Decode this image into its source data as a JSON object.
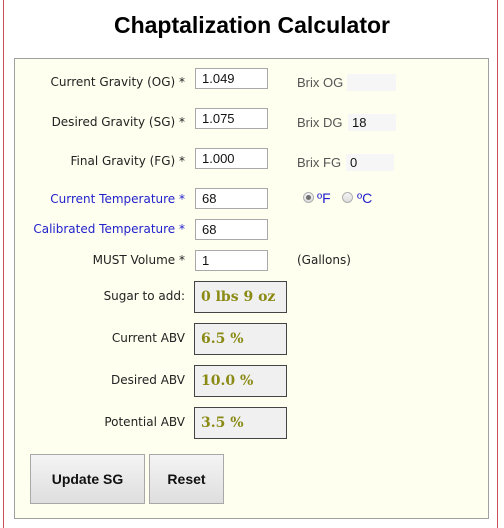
{
  "title": "Chaptalization Calculator",
  "fields": {
    "og": {
      "label": "Current Gravity (OG) *",
      "value": "1.049"
    },
    "sg": {
      "label": "Desired Gravity (SG) *",
      "value": "1.075"
    },
    "fg": {
      "label": "Final Gravity (FG) *",
      "value": "1.000"
    },
    "current_temp": {
      "label": "Current Temperature *",
      "value": "68"
    },
    "calibrated_temp": {
      "label": "Calibrated Temperature *",
      "value": "68"
    },
    "volume": {
      "label": "MUST Volume *",
      "value": "1",
      "unit": "(Gallons)"
    }
  },
  "brix": {
    "og": {
      "label": "Brix OG",
      "value": ""
    },
    "dg": {
      "label": "Brix DG",
      "value": "18"
    },
    "fg": {
      "label": "Brix FG",
      "value": "0"
    }
  },
  "temperature_unit": {
    "options": [
      "ºF",
      "ºC"
    ],
    "selected": "ºF"
  },
  "results": {
    "sugar": {
      "label": "Sugar to add:",
      "value": "0 lbs 9 oz"
    },
    "current_abv": {
      "label": "Current ABV",
      "value": "6.5 %"
    },
    "desired_abv": {
      "label": "Desired ABV",
      "value": "10.0 %"
    },
    "potential_abv": {
      "label": "Potential ABV",
      "value": "3.5 %"
    }
  },
  "buttons": {
    "update": "Update SG",
    "reset": "Reset"
  },
  "colors": {
    "panel_bg": "#fffff0",
    "result_text": "#8a8a14",
    "temp_label": "#2222cc",
    "frame_border": "#c8505f"
  }
}
